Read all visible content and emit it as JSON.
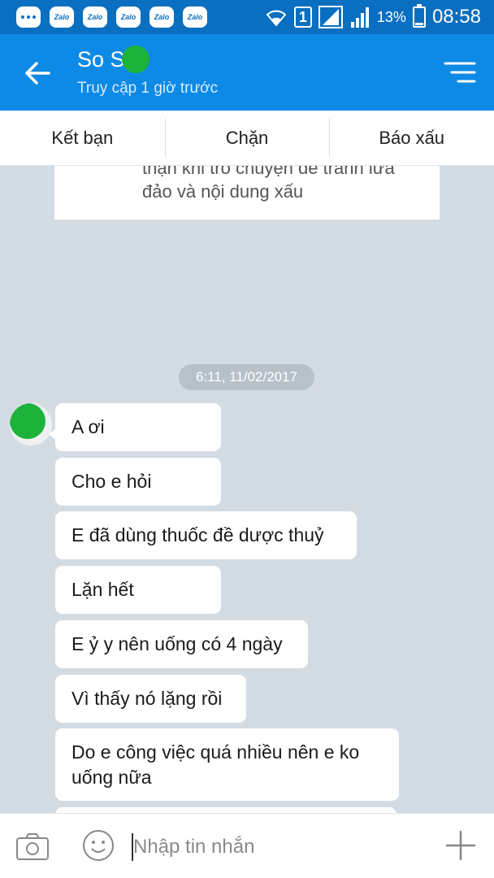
{
  "status_bar": {
    "notification_icons": [
      "more-dots-icon",
      "zalo-icon",
      "zalo-icon",
      "zalo-icon",
      "zalo-icon",
      "zalo-icon"
    ],
    "zalo_label": "Zalo",
    "sim_label": "1",
    "battery_percent": "13%",
    "battery_level": 0.13,
    "time": "08:58"
  },
  "header": {
    "contact_name": "So S",
    "last_seen": "Truy cập 1 giờ trước"
  },
  "actions": {
    "add_friend": "Kết bạn",
    "block": "Chặn",
    "report": "Báo xấu"
  },
  "chat": {
    "warning_line1": "thận khi trò chuyện để tránh lừa",
    "warning_line2": "đảo và nội dung xấu",
    "timestamp": "6:11, 11/02/2017",
    "messages": [
      "A ơi",
      "Cho e hỏi",
      "E đã dùng thuốc đề dược thuỷ",
      "Lặn hết",
      "E ỷ y nên uống có 4 ngày",
      "Vì thấy nó lặng rồi",
      "Do e công việc quá nhiều nên e ko uống nữa"
    ]
  },
  "input": {
    "placeholder": "Nhập tin nhắn"
  },
  "colors": {
    "status_bar": "#0a6fc0",
    "app_bar": "#0d8ae6",
    "chat_background": "#d4dce3",
    "avatar_overlay": "#1db33a"
  }
}
